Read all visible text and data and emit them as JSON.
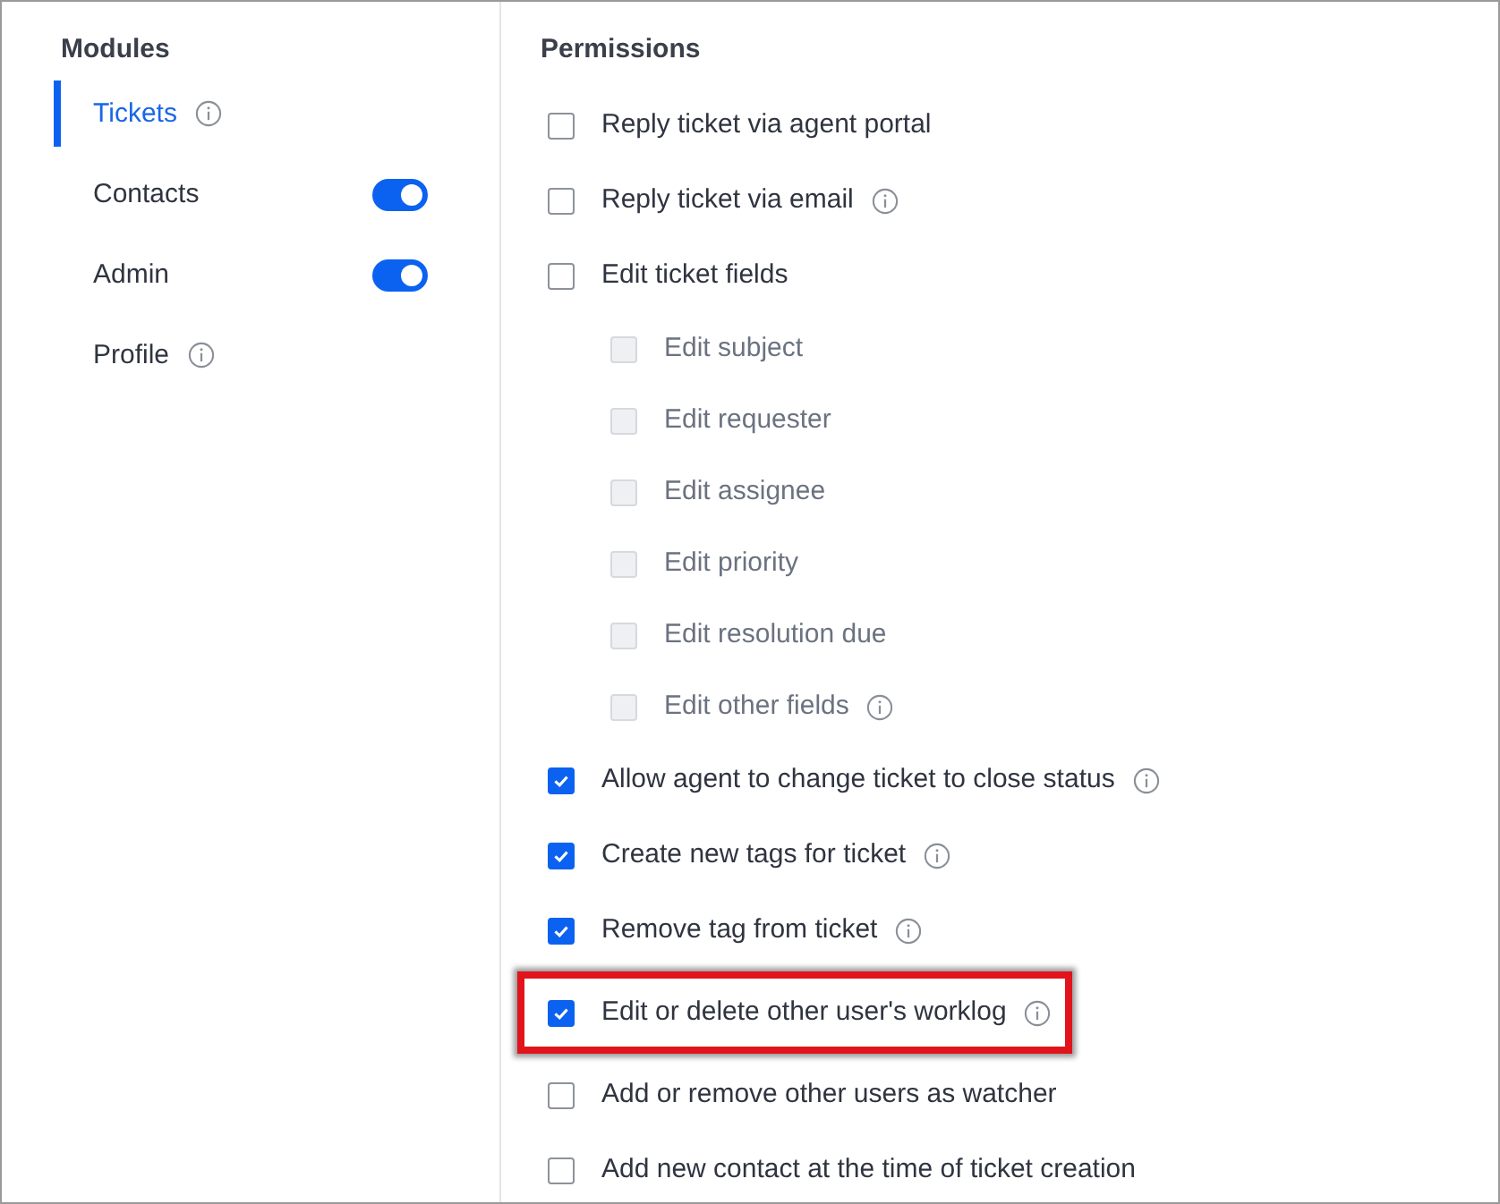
{
  "modules": {
    "heading": "Modules",
    "items": [
      {
        "label": "Tickets",
        "selected": true,
        "info": true
      },
      {
        "label": "Contacts",
        "selected": false,
        "toggle": true
      },
      {
        "label": "Admin",
        "selected": false,
        "toggle": true
      },
      {
        "label": "Profile",
        "selected": false,
        "info": true
      }
    ]
  },
  "permissions": {
    "heading": "Permissions",
    "items": [
      {
        "label": "Reply ticket via agent portal",
        "checked": false
      },
      {
        "label": "Reply ticket via email",
        "checked": false,
        "info": true
      },
      {
        "label": "Edit ticket fields",
        "checked": false,
        "children": [
          {
            "label": "Edit subject",
            "checked": false,
            "disabled": true
          },
          {
            "label": "Edit requester",
            "checked": false,
            "disabled": true
          },
          {
            "label": "Edit assignee",
            "checked": false,
            "disabled": true
          },
          {
            "label": "Edit priority",
            "checked": false,
            "disabled": true
          },
          {
            "label": "Edit resolution due",
            "checked": false,
            "disabled": true
          },
          {
            "label": "Edit other fields",
            "checked": false,
            "disabled": true,
            "info": true
          }
        ]
      },
      {
        "label": "Allow agent to change ticket to close status",
        "checked": true,
        "info": true
      },
      {
        "label": "Create new tags for ticket",
        "checked": true,
        "info": true
      },
      {
        "label": "Remove tag from ticket",
        "checked": true,
        "info": true
      },
      {
        "label": "Edit or delete other user's worklog",
        "checked": true,
        "info": true,
        "highlighted": true
      },
      {
        "label": "Add or remove other users as watcher",
        "checked": false
      },
      {
        "label": "Add new contact at the time of ticket creation",
        "checked": false
      }
    ]
  }
}
